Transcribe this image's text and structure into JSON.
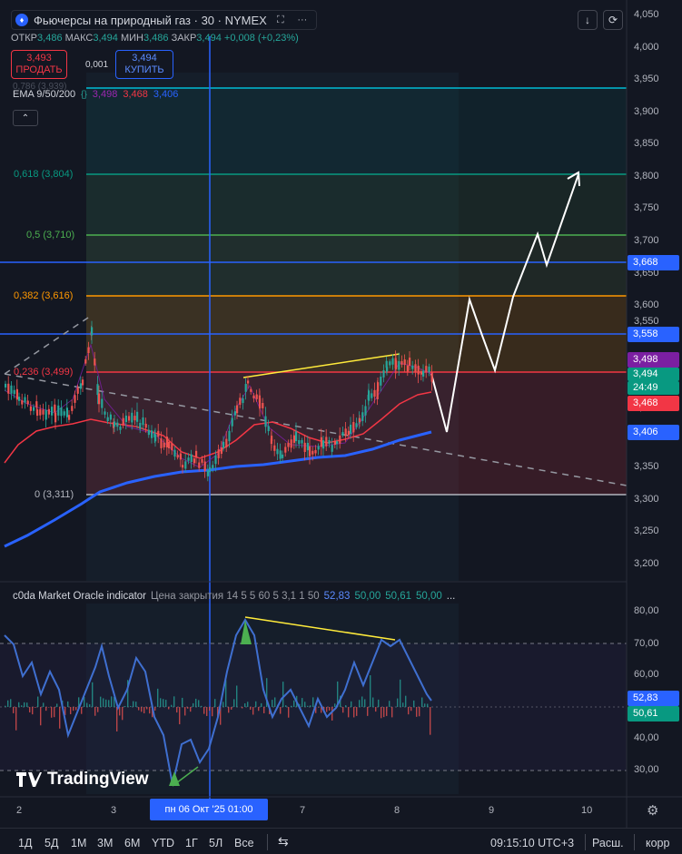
{
  "header": {
    "title": "Фьючерсы на природный газ · 30 · NYMEX",
    "icon": "flame-icon",
    "fullscreen_icon": "expand-icon",
    "more_icon": "ellipsis-icon",
    "download_icon": "download-icon",
    "refresh_icon": "refresh-icon"
  },
  "ohlc": {
    "open_label": "ОТКР",
    "open": "3,486",
    "high_label": "МАКС",
    "high": "3,494",
    "low_label": "МИН",
    "low": "3,486",
    "close_label": "ЗАКР",
    "close": "3,494",
    "change": "+0,008 (+0,23%)"
  },
  "trade": {
    "sell_price": "3,493",
    "sell_label": "ПРОДАТЬ",
    "spread": "0,001",
    "buy_price": "3,494",
    "buy_label": "КУПИТЬ"
  },
  "ema": {
    "label": "EMA 9/50/200",
    "v1": "3,498",
    "v2": "3,468",
    "v3": "3,406",
    "ghost": "0,786 (3,939)",
    "collapse_icon": "chevron-up-icon",
    "settings_icon": "braces-icon"
  },
  "fib_levels": [
    {
      "label": "0,618 (3,804)",
      "color": "#089981"
    },
    {
      "label": "0,5 (3,710)",
      "color": "#4caf50"
    },
    {
      "label": "0,382 (3,616)",
      "color": "#ff9800"
    },
    {
      "label": "0,236 (3,499)",
      "color": "#f23645"
    },
    {
      "label": "0 (3,311)",
      "color": "#b2b5be"
    }
  ],
  "price_axis": [
    "4,050",
    "4,000",
    "3,950",
    "3,900",
    "3,850",
    "3,800",
    "3,750",
    "3,700",
    "3,650",
    "3,600",
    "3,550",
    "3,450",
    "3,350",
    "3,300",
    "3,250",
    "3,200"
  ],
  "price_labels": [
    {
      "text": "3,668",
      "color": "#2962ff"
    },
    {
      "text": "3,558",
      "color": "#2962ff"
    },
    {
      "text": "3,498",
      "color": "#7b1fa2"
    },
    {
      "text": "3,494",
      "color": "#089981"
    },
    {
      "text": "24:49",
      "color": "#089981"
    },
    {
      "text": "3,468",
      "color": "#f23645"
    },
    {
      "text": "3,406",
      "color": "#2962ff"
    }
  ],
  "indicator": {
    "name": "c0da Market Oracle indicator",
    "params": "Цена закрытия 14 5 5 60 5 3,1 1 50",
    "v1": "52,83",
    "v2": "50,00",
    "v3": "50,61",
    "v4": "50,00",
    "more": "...",
    "axis": [
      "80,00",
      "70,00",
      "60,00",
      "40,00",
      "30,00"
    ],
    "label1": "52,83",
    "label2": "50,61"
  },
  "time_axis": {
    "ticks": [
      "2",
      "3",
      "7",
      "8",
      "9",
      "10"
    ],
    "cursor": "пн 06 Окт '25   01:00",
    "settings_icon": "gear-icon"
  },
  "bottom": {
    "ranges": [
      "1Д",
      "5Д",
      "1М",
      "3М",
      "6М",
      "YTD",
      "1Г",
      "5Л",
      "Все"
    ],
    "compare_icon": "calendar-range-icon",
    "time": "09:15:10 UTC+3",
    "session": "Расш.",
    "adj": "корр"
  },
  "logo": {
    "text": "TradingView"
  },
  "colors": {
    "bg": "#131722",
    "up": "#26a69a",
    "down": "#ef5350",
    "ema_fast": "#9c27b0",
    "ema_mid": "#f23645",
    "ema_slow": "#2962ff"
  }
}
